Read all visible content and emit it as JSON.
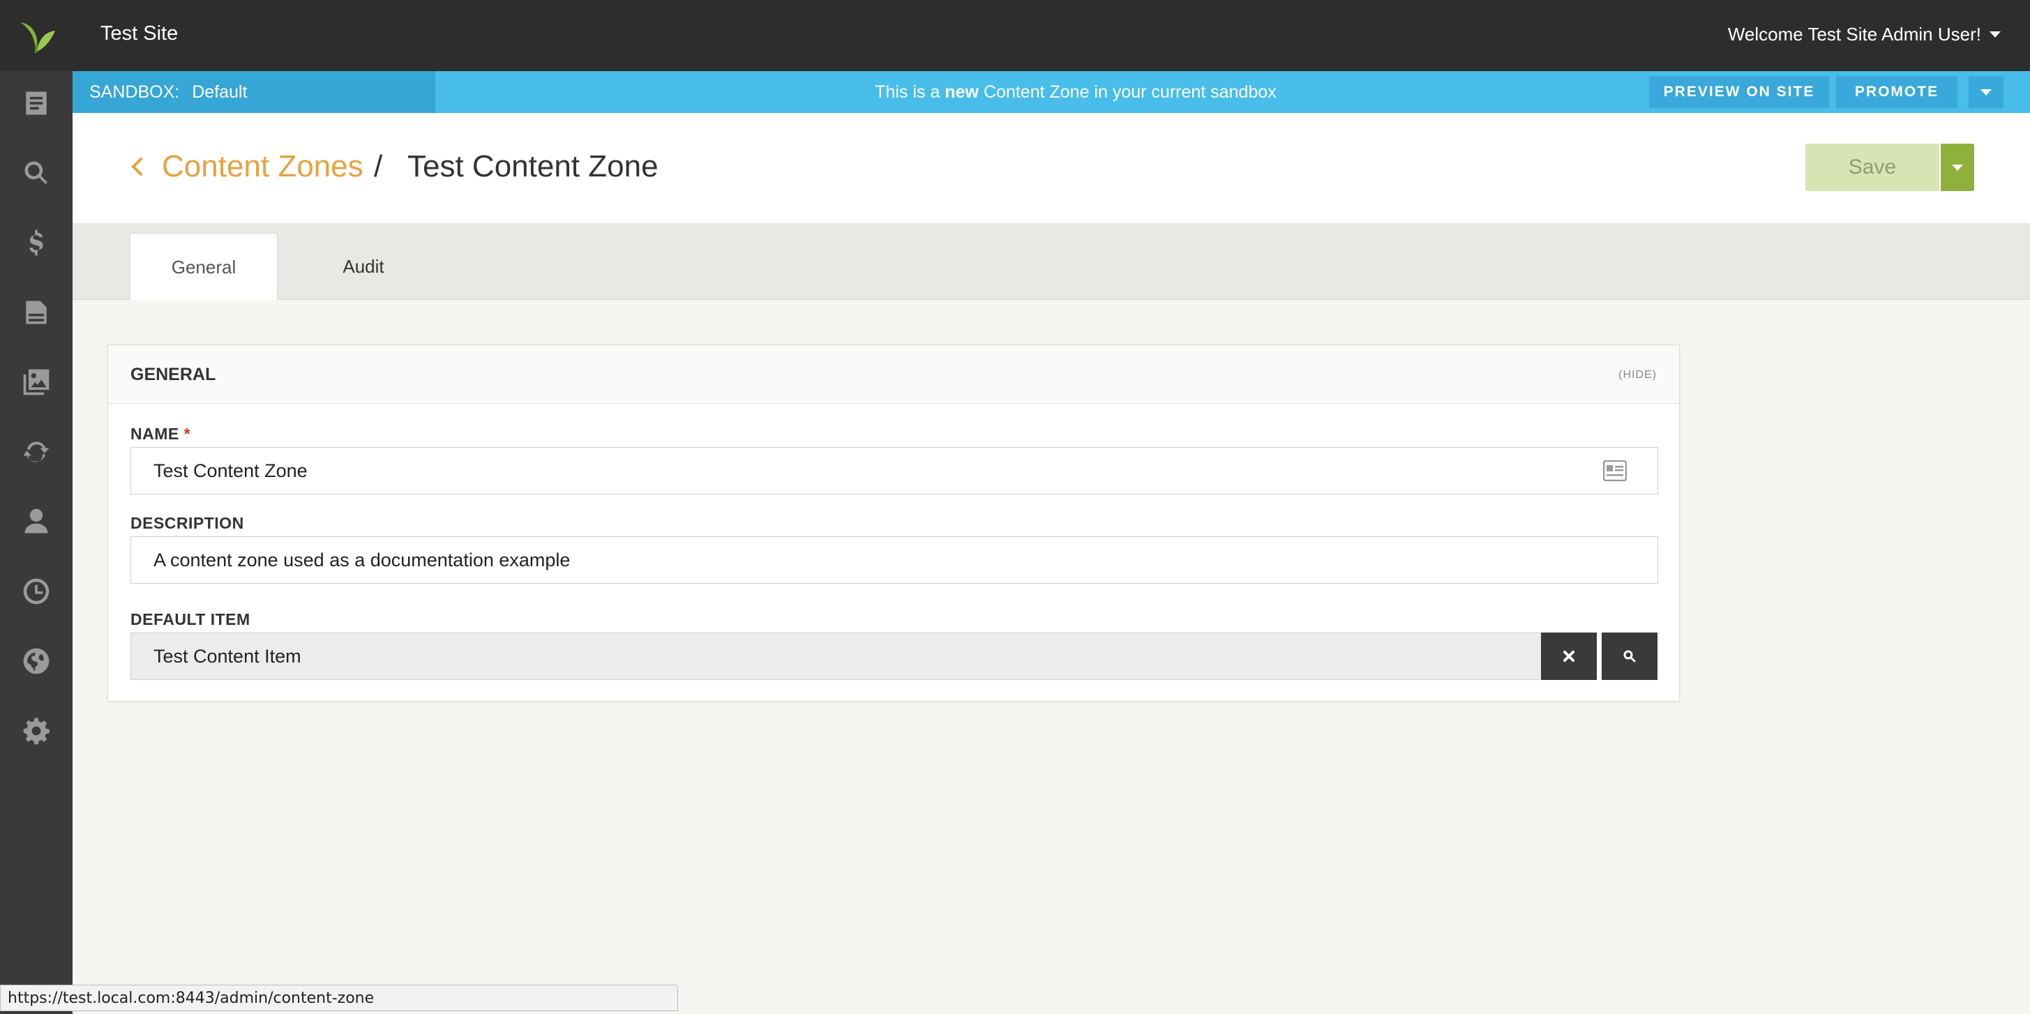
{
  "app": {
    "site_title": "Test Site",
    "welcome": "Welcome Test Site Admin User!"
  },
  "sidebar": {
    "icons": [
      "logo-leaf-icon",
      "content-icon",
      "search-icon",
      "dollar-icon",
      "pages-icon",
      "assets-icon",
      "sync-icon",
      "user-icon",
      "history-icon",
      "globe-icon",
      "settings-icon"
    ]
  },
  "sandbox": {
    "label": "SANDBOX:",
    "value": "Default",
    "message_pre": "This is a",
    "message_bold": "new",
    "message_post": "Content Zone in your current sandbox",
    "preview_label": "PREVIEW ON SITE",
    "promote_label": "PROMOTE"
  },
  "header": {
    "breadcrumb_link": "Content Zones",
    "separator": "/",
    "current": "Test Content Zone",
    "save_label": "Save"
  },
  "tabs": [
    {
      "label": "General",
      "active": true
    },
    {
      "label": "Audit",
      "active": false
    }
  ],
  "panel": {
    "title": "GENERAL",
    "hide_label": "(HIDE)",
    "fields": {
      "name_label": "NAME",
      "name_required": "*",
      "name_value": "Test Content Zone",
      "description_label": "DESCRIPTION",
      "description_value": "A content zone used as a documentation example",
      "default_item_label": "DEFAULT ITEM",
      "default_item_value": "Test Content Item"
    }
  },
  "status_bar": {
    "url": "https://test.local.com:8443/admin/content-zone"
  },
  "colors": {
    "accent_orange": "#e6a341",
    "sandbox_blue": "#48bde9",
    "save_green": "#8fb03b",
    "topbar_dark": "#2d2d2d"
  }
}
